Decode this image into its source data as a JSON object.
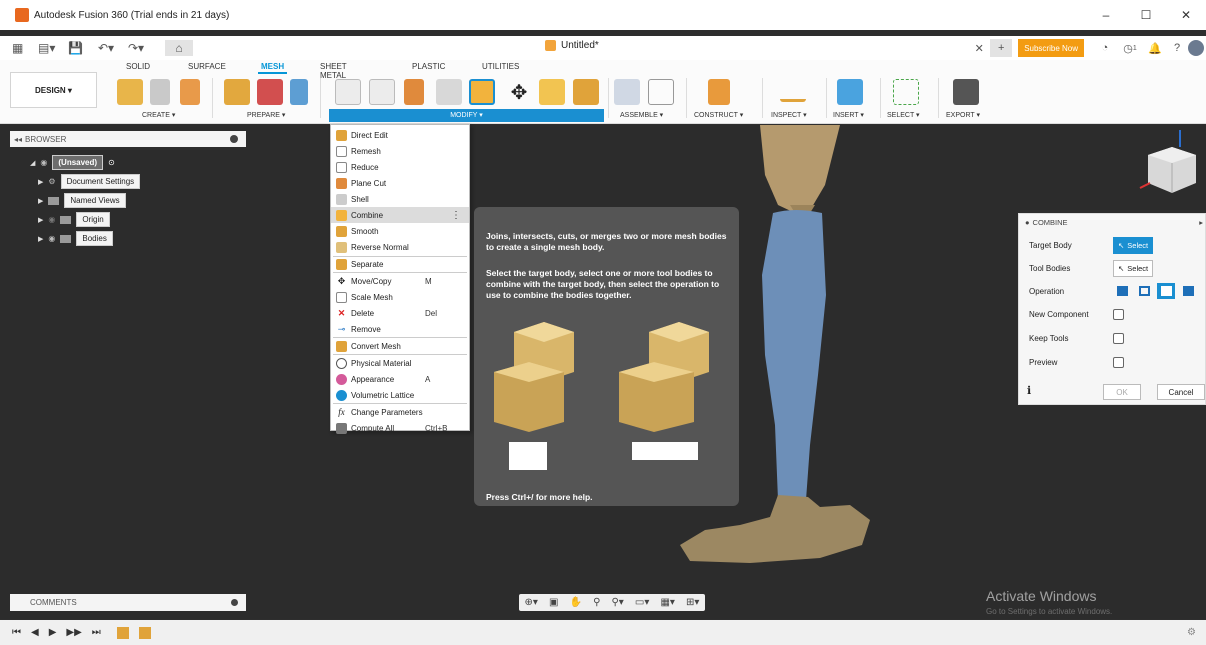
{
  "window": {
    "title": "Autodesk Fusion 360 (Trial ends in 21 days)",
    "controls": [
      "–",
      "☐",
      "✕"
    ]
  },
  "tabbar": {
    "doc_title": "Untitled*",
    "subscribe": "Subscribe Now",
    "job_count": "1"
  },
  "ribbon": {
    "workspace": "DESIGN ▾",
    "tabs": [
      "SOLID",
      "SURFACE",
      "MESH",
      "SHEET METAL",
      "PLASTIC",
      "UTILITIES"
    ],
    "groups": [
      "CREATE ▾",
      "PREPARE ▾",
      "MODIFY ▾",
      "ASSEMBLE ▾",
      "CONSTRUCT ▾",
      "INSPECT ▾",
      "INSERT ▾",
      "SELECT ▾",
      "EXPORT ▾"
    ]
  },
  "browser": {
    "title": "BROWSER",
    "items": [
      "(Unsaved)",
      "Document Settings",
      "Named Views",
      "Origin",
      "Bodies"
    ]
  },
  "menu": {
    "items": [
      {
        "label": "Direct Edit",
        "shortcut": ""
      },
      {
        "label": "Remesh",
        "shortcut": ""
      },
      {
        "label": "Reduce",
        "shortcut": ""
      },
      {
        "label": "Plane Cut",
        "shortcut": ""
      },
      {
        "label": "Shell",
        "shortcut": ""
      },
      {
        "label": "Combine",
        "shortcut": ""
      },
      {
        "label": "Smooth",
        "shortcut": ""
      },
      {
        "label": "Reverse Normal",
        "shortcut": ""
      },
      {
        "label": "Separate",
        "shortcut": ""
      },
      {
        "label": "Move/Copy",
        "shortcut": "M"
      },
      {
        "label": "Scale Mesh",
        "shortcut": ""
      },
      {
        "label": "Delete",
        "shortcut": "Del"
      },
      {
        "label": "Remove",
        "shortcut": ""
      },
      {
        "label": "Convert Mesh",
        "shortcut": ""
      },
      {
        "label": "Physical Material",
        "shortcut": ""
      },
      {
        "label": "Appearance",
        "shortcut": "A"
      },
      {
        "label": "Volumetric Lattice",
        "shortcut": ""
      },
      {
        "label": "Change Parameters",
        "shortcut": ""
      },
      {
        "label": "Compute All",
        "shortcut": "Ctrl+B"
      }
    ]
  },
  "tooltip": {
    "para1": "Joins, intersects, cuts, or merges two or more mesh bodies to create a single mesh body.",
    "para2": "Select the target body, select one or more tool bodies to combine with the target body, then select the operation to use to combine the bodies together.",
    "help": "Press Ctrl+/ for more help."
  },
  "combine": {
    "title": "COMBINE",
    "target_body": "Target Body",
    "tool_bodies": "Tool Bodies",
    "operation": "Operation",
    "new_component": "New Component",
    "keep_tools": "Keep Tools",
    "preview": "Preview",
    "select": "Select",
    "ok": "OK",
    "cancel": "Cancel"
  },
  "comments": {
    "title": "COMMENTS"
  },
  "watermark": {
    "title": "Activate Windows",
    "subtitle": "Go to Settings to activate Windows."
  },
  "colors": {
    "accent": "#0696d7",
    "subscribe": "#f39c12",
    "viewport": "#2c2c2c"
  }
}
